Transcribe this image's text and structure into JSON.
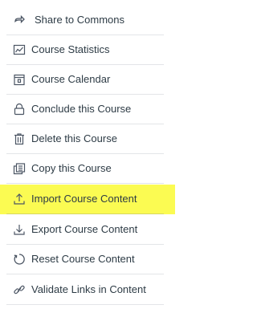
{
  "menu": {
    "items": [
      {
        "label": "Share to Commons",
        "icon": "share-icon"
      },
      {
        "label": "Course Statistics",
        "icon": "statistics-icon"
      },
      {
        "label": "Course Calendar",
        "icon": "calendar-icon"
      },
      {
        "label": "Conclude this Course",
        "icon": "lock-icon"
      },
      {
        "label": "Delete this Course",
        "icon": "trash-icon"
      },
      {
        "label": "Copy this Course",
        "icon": "copy-icon"
      },
      {
        "label": "Import Course Content",
        "icon": "upload-icon"
      },
      {
        "label": "Export Course Content",
        "icon": "download-icon"
      },
      {
        "label": "Reset Course Content",
        "icon": "reset-icon"
      },
      {
        "label": "Validate Links in Content",
        "icon": "link-icon"
      }
    ]
  },
  "colors": {
    "text": "#2d3b45",
    "highlight": "#fbfb52",
    "divider": "#e3e5e8"
  }
}
